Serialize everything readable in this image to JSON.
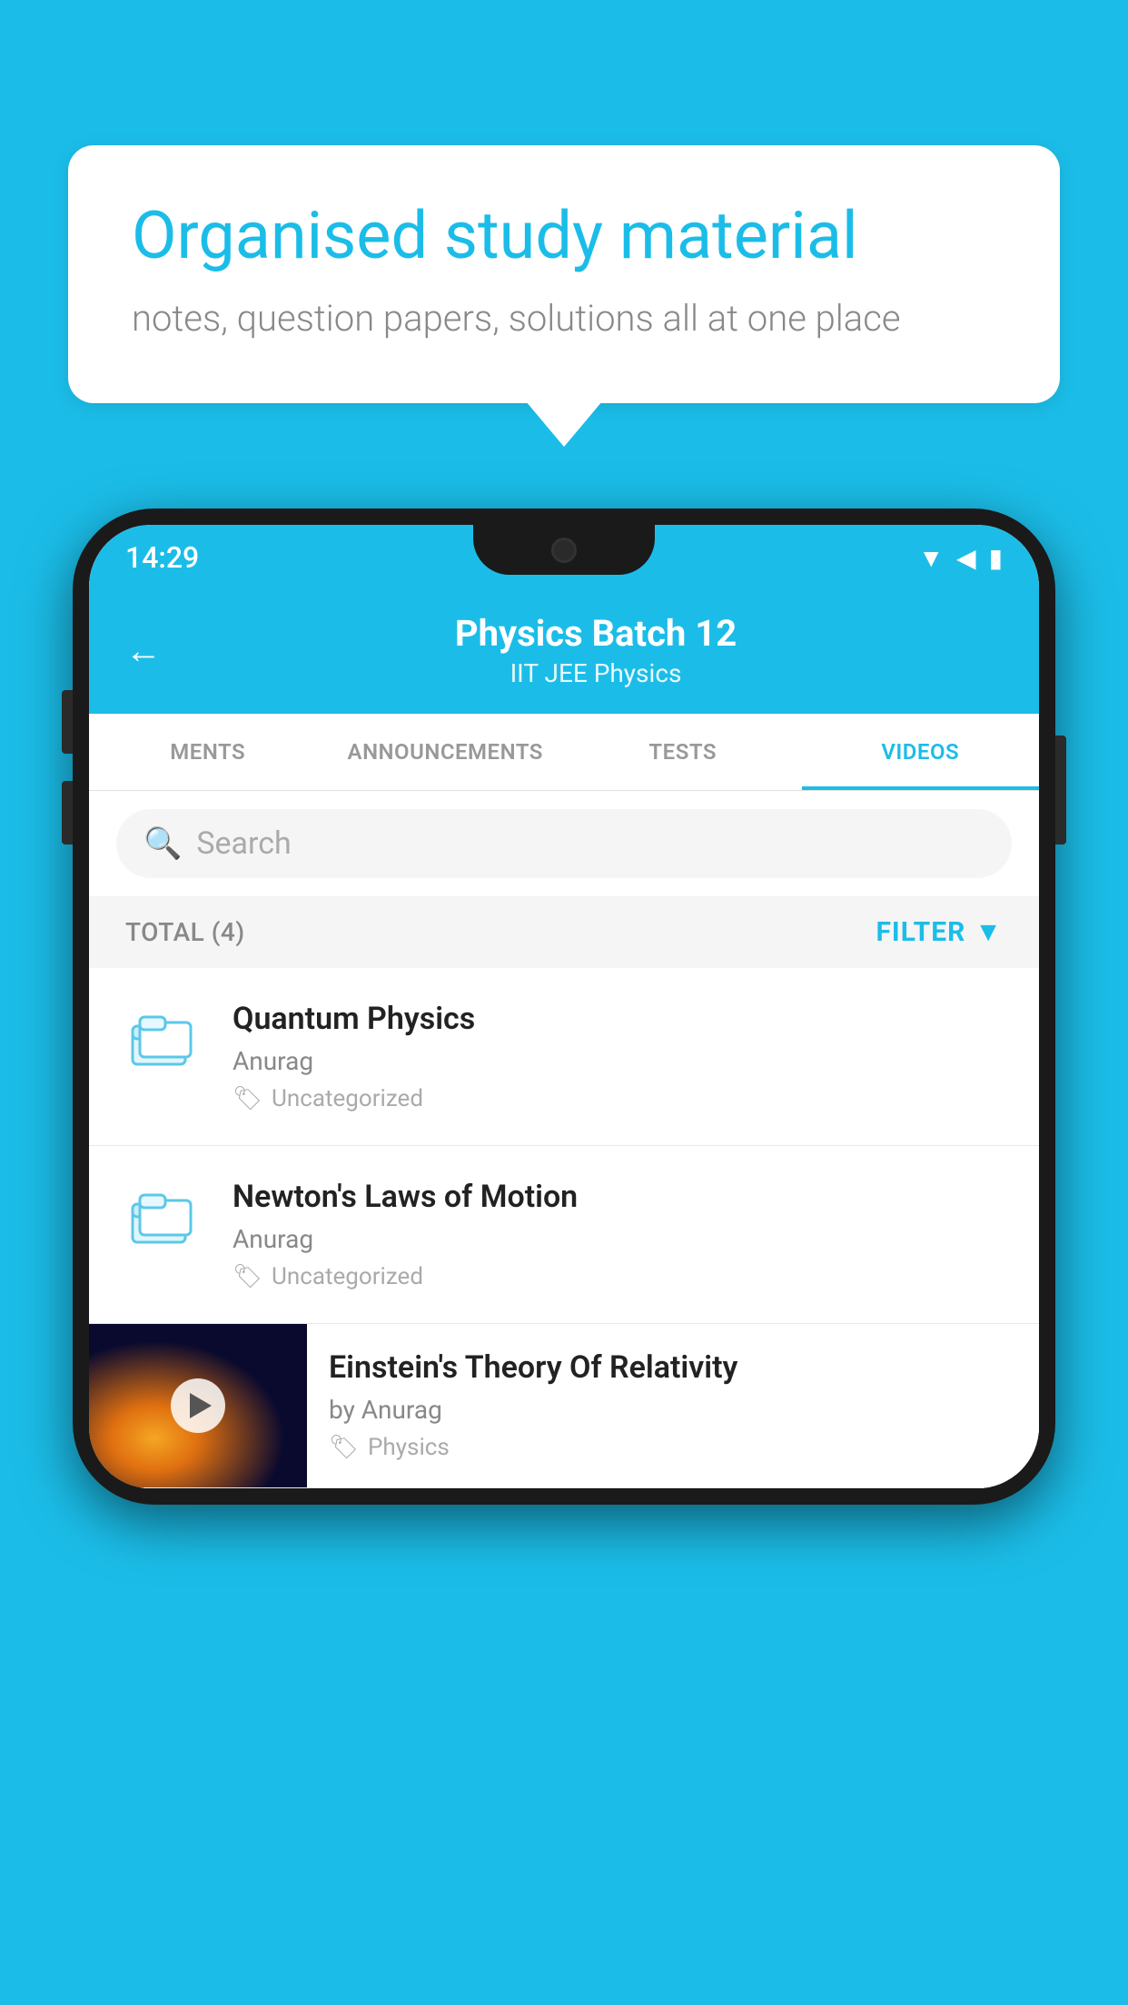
{
  "background": {
    "color": "#1bbde8"
  },
  "speech_bubble": {
    "heading": "Organised study material",
    "subtext": "notes, question papers, solutions all at one place"
  },
  "phone": {
    "status_bar": {
      "time": "14:29"
    },
    "header": {
      "title": "Physics Batch 12",
      "subtitle": "IIT JEE   Physics",
      "back_label": "←"
    },
    "tabs": [
      {
        "label": "MENTS",
        "active": false
      },
      {
        "label": "ANNOUNCEMENTS",
        "active": false
      },
      {
        "label": "TESTS",
        "active": false
      },
      {
        "label": "VIDEOS",
        "active": true
      }
    ],
    "search": {
      "placeholder": "Search"
    },
    "filter_row": {
      "total_label": "TOTAL (4)",
      "filter_label": "FILTER"
    },
    "videos": [
      {
        "title": "Quantum Physics",
        "author": "Anurag",
        "tag": "Uncategorized",
        "has_thumbnail": false
      },
      {
        "title": "Newton's Laws of Motion",
        "author": "Anurag",
        "tag": "Uncategorized",
        "has_thumbnail": false
      },
      {
        "title": "Einstein's Theory Of Relativity",
        "author": "by Anurag",
        "tag": "Physics",
        "has_thumbnail": true
      }
    ]
  }
}
